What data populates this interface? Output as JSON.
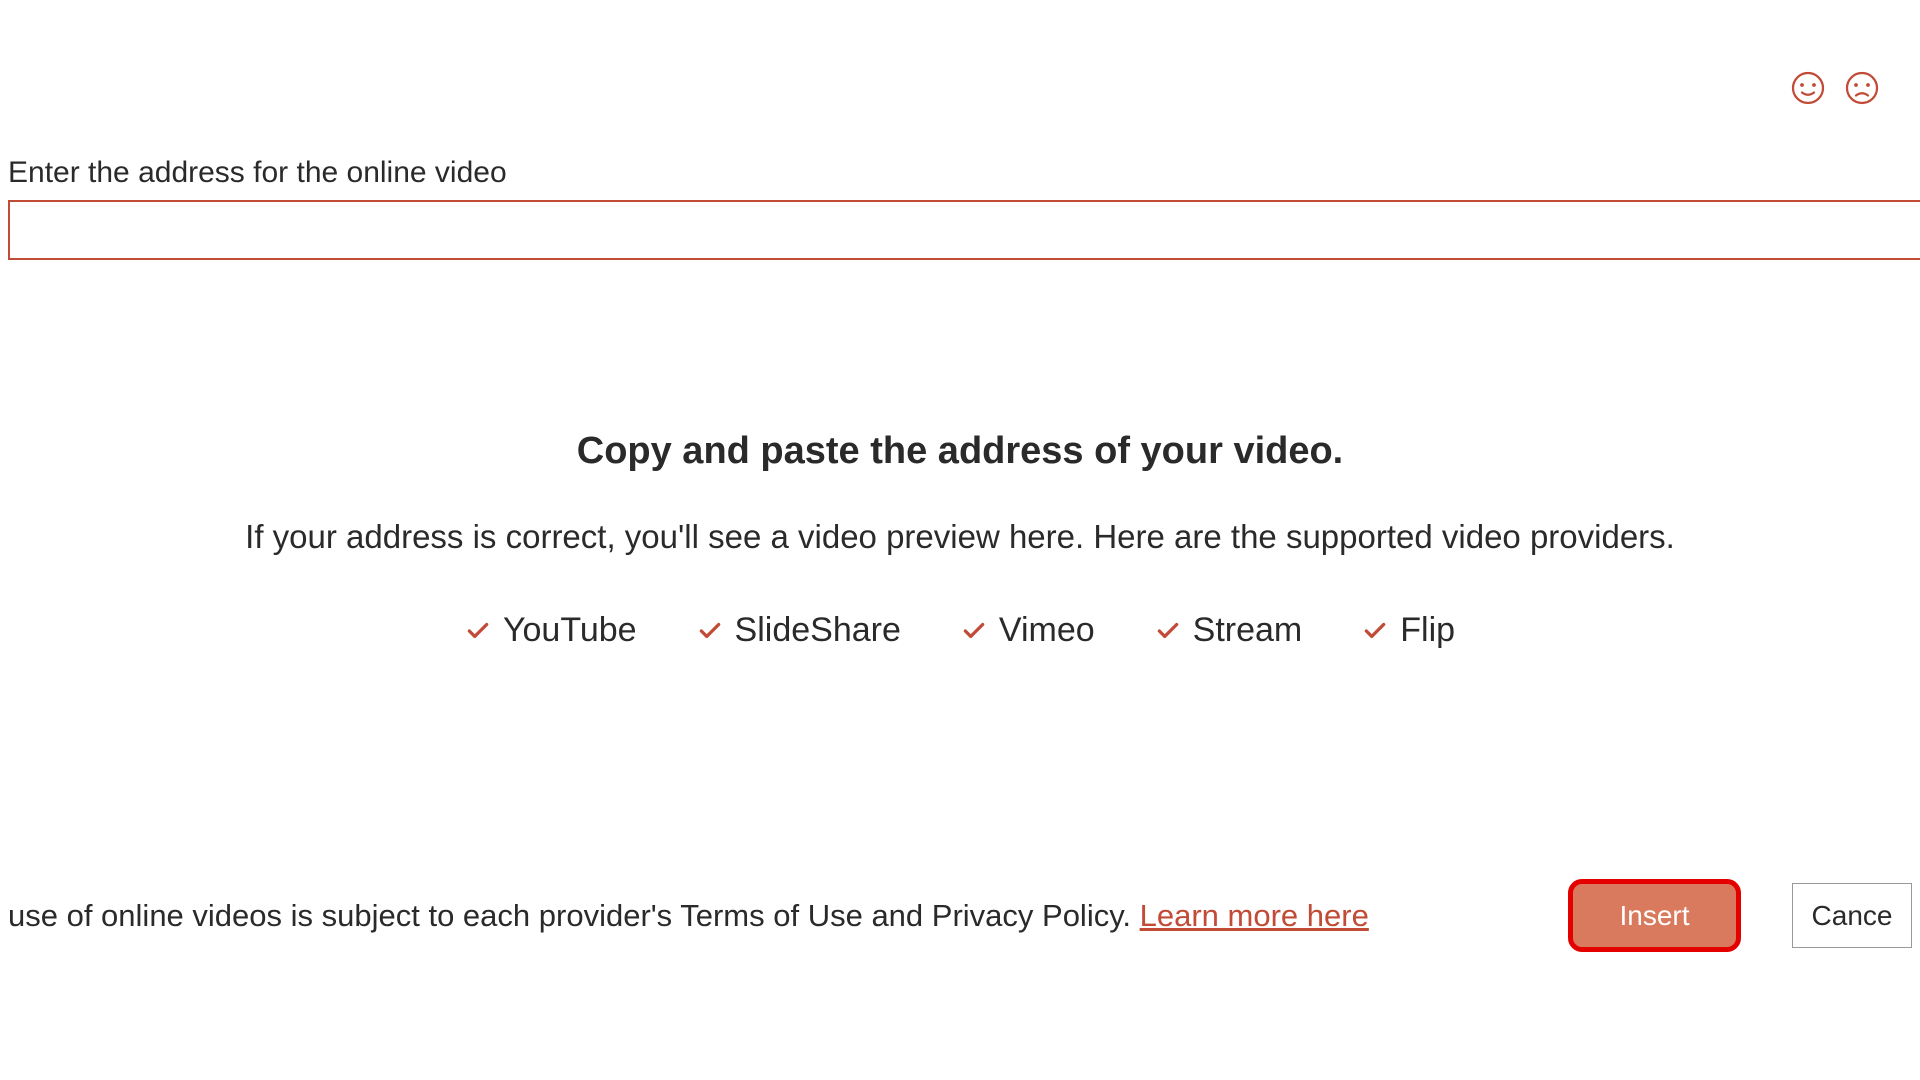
{
  "feedback": {
    "happy": "smile-icon",
    "sad": "frown-icon"
  },
  "input": {
    "label": "Enter the address for the online video",
    "value": ""
  },
  "content": {
    "heading": "Copy and paste the address of your video.",
    "subtext": "If your address is correct, you'll see a video preview here. Here are the supported video providers."
  },
  "providers": [
    "YouTube",
    "SlideShare",
    "Vimeo",
    "Stream",
    "Flip"
  ],
  "footer": {
    "terms_text": "use of online videos is subject to each provider's Terms of Use and Privacy Policy.   ",
    "learn_more": "Learn more here",
    "insert_label": "Insert",
    "cancel_label": "Cance"
  }
}
